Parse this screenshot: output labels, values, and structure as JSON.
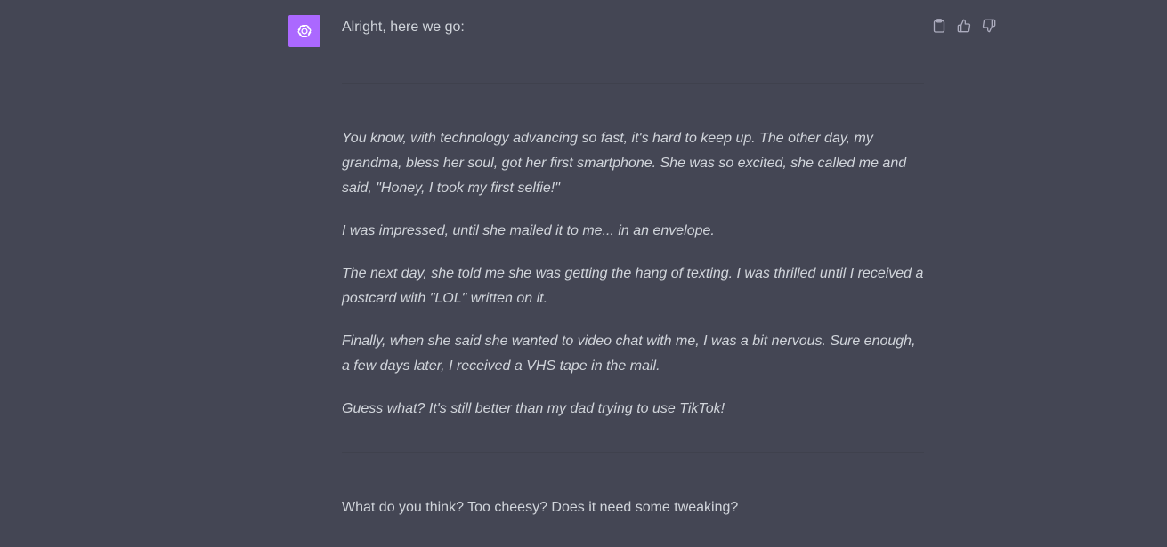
{
  "message": {
    "avatar_icon": "openai-logo-icon",
    "avatar_color": "#ab68ff",
    "intro": "Alright, here we go:",
    "joke_paragraphs": [
      "You know, with technology advancing so fast, it's hard to keep up. The other day, my grandma, bless her soul, got her first smartphone. She was so excited, she called me and said, \"Honey, I took my first selfie!\"",
      "I was impressed, until she mailed it to me... in an envelope.",
      "The next day, she told me she was getting the hang of texting. I was thrilled until I received a postcard with \"LOL\" written on it.",
      "Finally, when she said she wanted to video chat with me, I was a bit nervous. Sure enough, a few days later, I received a VHS tape in the mail.",
      "Guess what? It's still better than my dad trying to use TikTok!"
    ],
    "closing": "What do you think? Too cheesy? Does it need some tweaking?"
  },
  "actions": {
    "copy_icon": "clipboard-icon",
    "like_icon": "thumbs-up-icon",
    "dislike_icon": "thumbs-down-icon"
  },
  "colors": {
    "background": "#444654",
    "text": "#d1d5db",
    "icon": "#acacbe",
    "divider": "#3f414d"
  }
}
